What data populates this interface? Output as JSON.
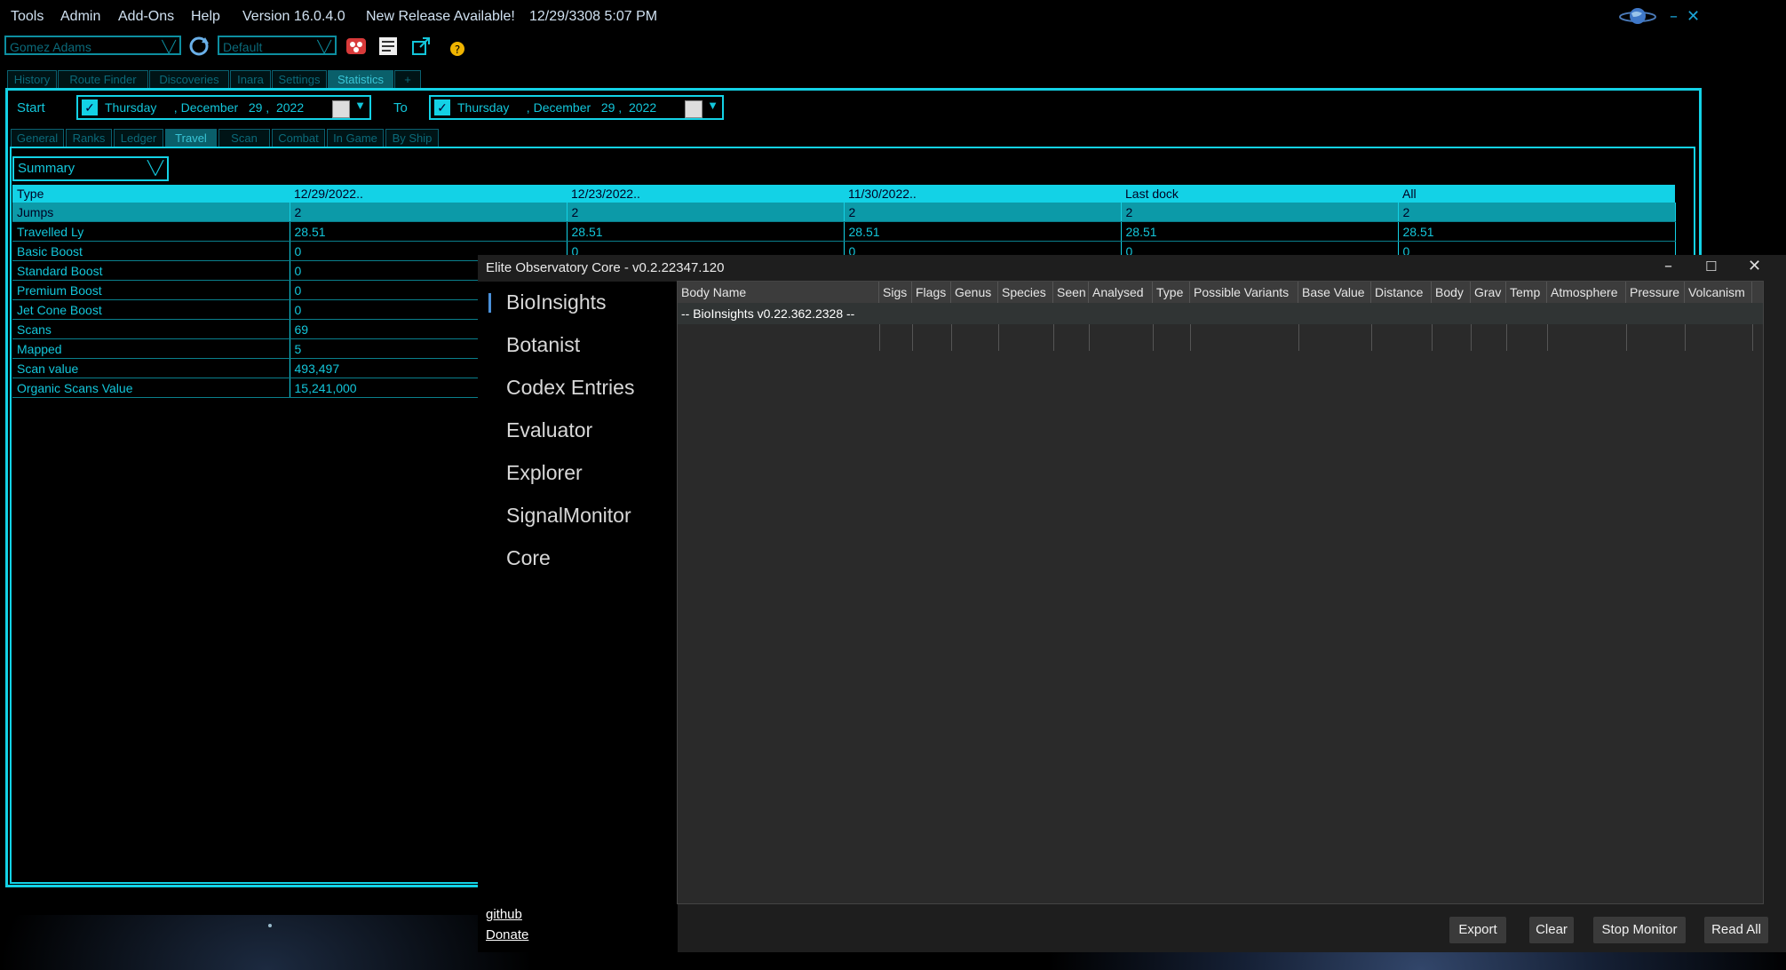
{
  "menu": {
    "items": [
      "Tools",
      "Admin",
      "Add-Ons",
      "Help"
    ],
    "version": "Version 16.0.4.0",
    "new_release": "New Release Available!",
    "datetime": "12/29/3308 5:07 PM"
  },
  "toolbar": {
    "commander": "Gomez Adams",
    "profile": "Default"
  },
  "main_tabs": [
    "History",
    "Route Finder",
    "Discoveries",
    "Inara",
    "Settings",
    "Statistics",
    "+"
  ],
  "date_range": {
    "start_label": "Start",
    "start_value": "Thursday     , December   29 ,  2022",
    "to_label": "To",
    "to_value": "Thursday     , December   29 ,  2022"
  },
  "sub_tabs": [
    "General",
    "Ranks",
    "Ledger",
    "Travel",
    "Scan",
    "Combat",
    "In Game",
    "By Ship"
  ],
  "summary_select": "Summary",
  "stats_table": {
    "headers": [
      "Type",
      "12/29/2022..",
      "12/23/2022..",
      "11/30/2022..",
      "Last dock",
      "All"
    ],
    "rows": [
      [
        "Jumps",
        "2",
        "2",
        "2",
        "2",
        "2"
      ],
      [
        "Travelled Ly",
        "28.51",
        "28.51",
        "28.51",
        "28.51",
        "28.51"
      ],
      [
        "Basic Boost",
        "0",
        "0",
        "0",
        "0",
        "0"
      ],
      [
        "Standard Boost",
        "0"
      ],
      [
        "Premium Boost",
        "0"
      ],
      [
        "Jet Cone Boost",
        "0"
      ],
      [
        "Scans",
        "69"
      ],
      [
        "Mapped",
        "5"
      ],
      [
        "Scan value",
        "493,497"
      ],
      [
        "Organic Scans Value",
        "15,241,000"
      ]
    ]
  },
  "observatory": {
    "title": "Elite Observatory Core - v0.2.22347.120",
    "nav": [
      "BioInsights",
      "Botanist",
      "Codex Entries",
      "Evaluator",
      "Explorer",
      "SignalMonitor",
      "Core"
    ],
    "columns": [
      "Body Name",
      "Sigs",
      "Flags",
      "Genus",
      "Species",
      "Seen",
      "Analysed",
      "Type",
      "Possible Variants",
      "Base Value",
      "Distance",
      "Body",
      "Grav",
      "Temp",
      "Atmosphere",
      "Pressure",
      "Volcanism"
    ],
    "row_text": "-- BioInsights v0.22.362.2328 --",
    "links": {
      "github": "github",
      "donate": "Donate"
    },
    "buttons": {
      "export": "Export",
      "clear": "Clear",
      "stop": "Stop Monitor",
      "read_all": "Read All"
    }
  }
}
